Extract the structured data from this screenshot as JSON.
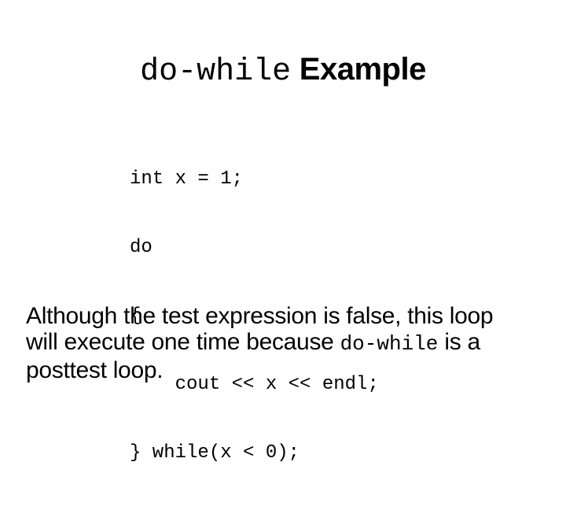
{
  "slide": {
    "background_color": "#ffffff",
    "text_color": "#000000",
    "title": {
      "mono_part": "do-while",
      "sans_part": " Example"
    },
    "code": {
      "language": "cpp",
      "lines": [
        "int x = 1;",
        "do",
        "{",
        "    cout << x << endl;",
        "} while(x < 0);"
      ]
    },
    "body": {
      "before_mono": "Although the test expression is false, this loop will execute one time because ",
      "mono_term": "do-while",
      "after_mono": " is a posttest loop."
    }
  }
}
